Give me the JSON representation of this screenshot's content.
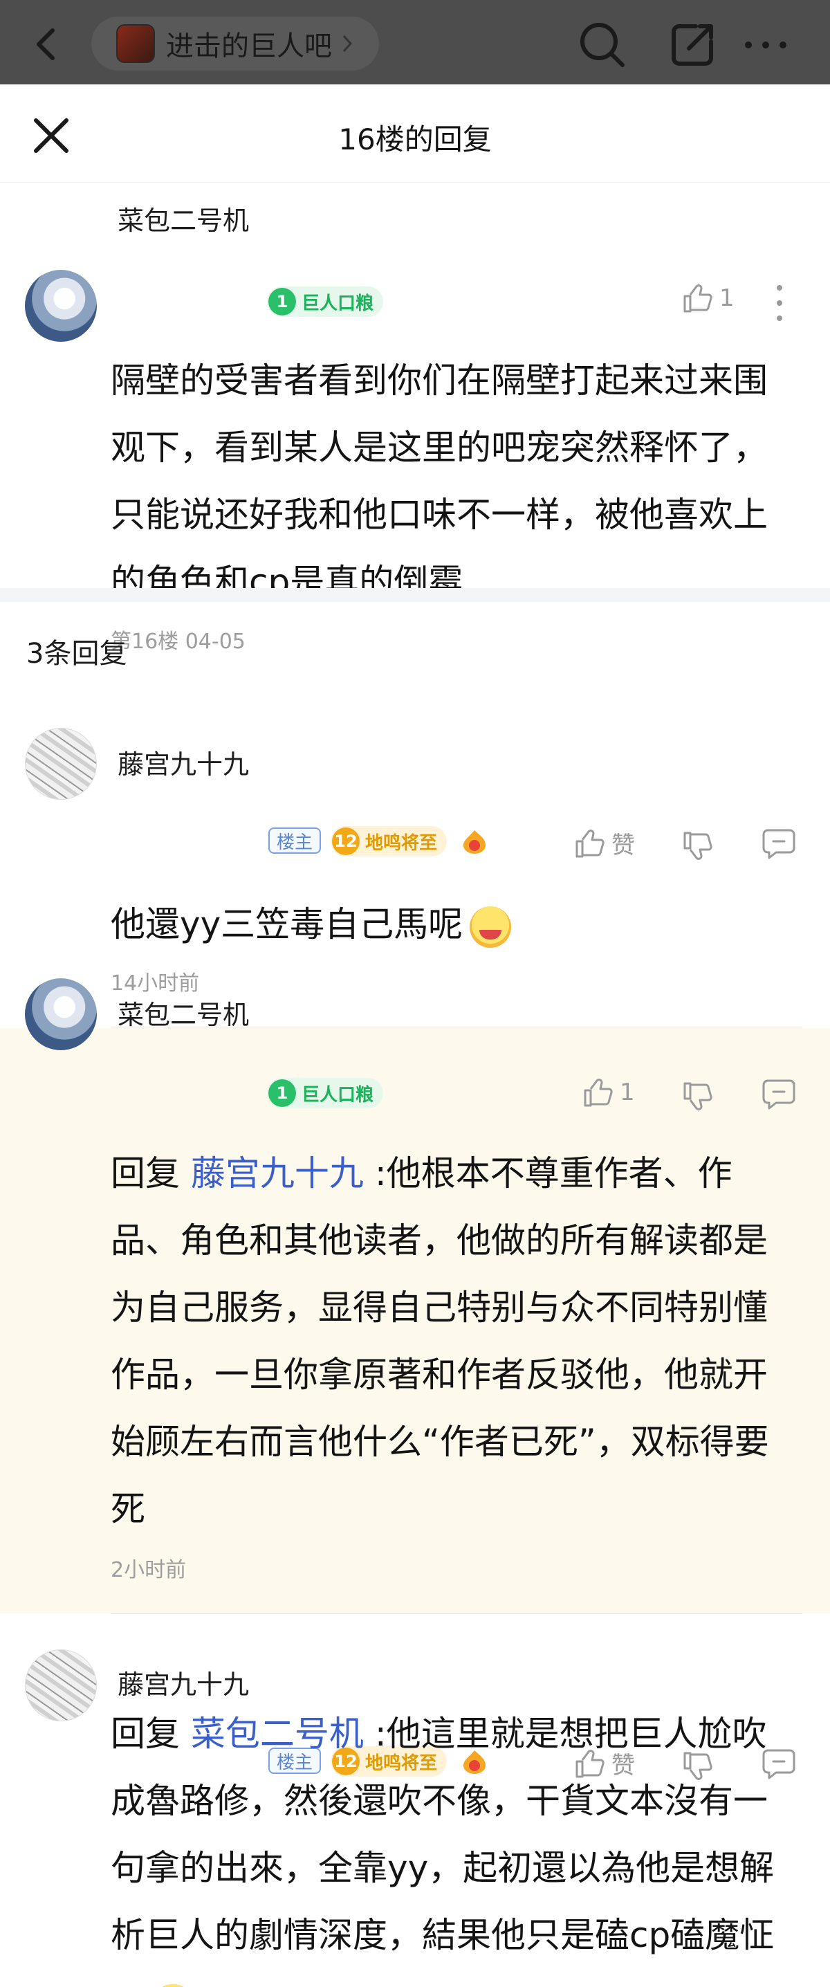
{
  "topbar": {
    "forum_name": "进击的巨人吧"
  },
  "sheet": {
    "title": "16楼的回复"
  },
  "main_post": {
    "username": "菜包二号机",
    "level": "1",
    "level_title": "巨人口粮",
    "like_count": "1",
    "text": "隔壁的受害者看到你们在隔壁打起来过来围观下，看到某人是这里的吧宠突然释怀了，只能说还好我和他口味不一样，被他喜欢上的角色和cp是真的倒霉",
    "meta": "第16楼  04-05"
  },
  "reply_count": "3条回复",
  "replies": [
    {
      "username": "藤宫九十九",
      "host_tag": "楼主",
      "level": "12",
      "level_title": "地鸣将至",
      "like_label": "赞",
      "text": "他還yy三笠毒自己馬呢",
      "time": "14小时前"
    },
    {
      "username": "菜包二号机",
      "level": "1",
      "level_title": "巨人口粮",
      "like_label": "1",
      "reply_prefix": "回复",
      "mention": "藤宫九十九",
      "text": ":他根本不尊重作者、作品、角色和其他读者，他做的所有解读都是为自己服务，显得自己特别与众不同特别懂作品，一旦你拿原著和作者反驳他，他就开始顾左右而言他什么“作者已死”，双标得要死",
      "time": "2小时前"
    },
    {
      "username": "藤宫九十九",
      "host_tag": "楼主",
      "level": "12",
      "level_title": "地鸣将至",
      "like_label": "赞",
      "reply_prefix": "回复",
      "mention": "菜包二号机",
      "text": ":他這里就是想把巨人尬吹成魯路修，然後還吹不像，干貨文本沒有一句拿的出來，全靠yy，起初還以為他是想解析巨人的劇情深度，結果他只是磕cp磕魔怔了"
    }
  ]
}
